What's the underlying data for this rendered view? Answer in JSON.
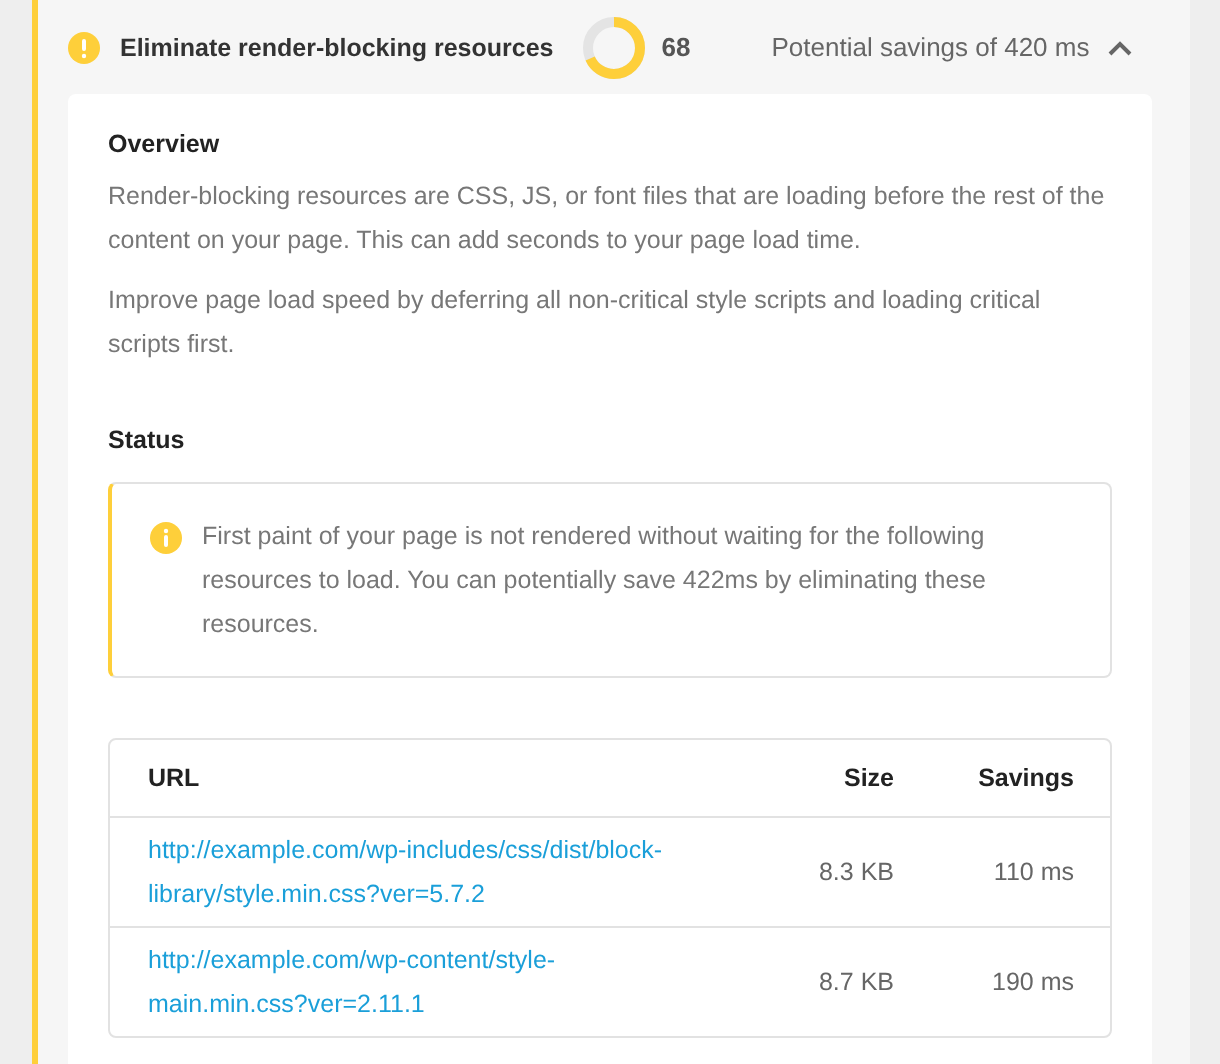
{
  "audit": {
    "title": "Eliminate render-blocking resources",
    "score": "68",
    "savings": "Potential savings of 420 ms",
    "expanded": true
  },
  "overview": {
    "heading": "Overview",
    "paragraphs": [
      "Render-blocking resources are CSS, JS, or font files that are loading before the rest of the content on your page. This can add seconds to your page load time.",
      "Improve page load speed by deferring all non-critical style scripts and loading critical scripts first."
    ]
  },
  "status": {
    "heading": "Status",
    "notice": "First paint of your page is not rendered without waiting for the following resources to load. You can potentially save 422ms by eliminating these resources."
  },
  "table": {
    "columns": [
      "URL",
      "Size",
      "Savings"
    ],
    "rows": [
      {
        "url": "http://example.com/wp-includes/css/dist/block-library/style.min.css?ver=5.7.2",
        "size": "8.3 KB",
        "savings": "110 ms"
      },
      {
        "url": "http://example.com/wp-content/style-main.min.css?ver=2.11.1",
        "size": "8.7 KB",
        "savings": "190 ms"
      }
    ]
  }
}
